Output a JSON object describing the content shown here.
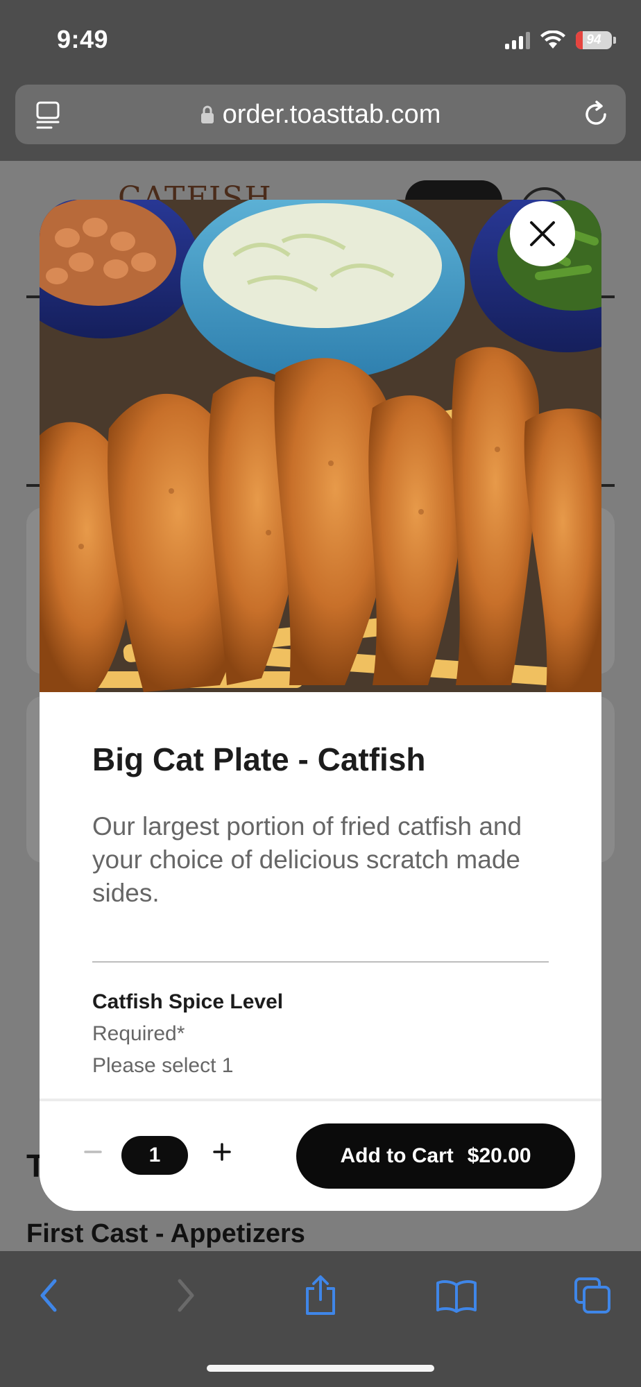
{
  "status_bar": {
    "time": "9:49",
    "battery": "94"
  },
  "browser": {
    "url": "order.toasttab.com"
  },
  "background_page": {
    "logo_text": "CATFISH",
    "partial_heading": "T",
    "section_title": "First Cast - Appetizers"
  },
  "modal": {
    "title": "Big Cat Plate - Catfish",
    "description": "Our largest portion of fried catfish and your choice of  delicious scratch made sides.",
    "modifier_group": {
      "title": "Catfish Spice Level",
      "required": "Required*",
      "instruction": "Please select 1"
    },
    "footer": {
      "quantity": "1",
      "add_to_cart_label": "Add to Cart",
      "price": "$20.00"
    }
  },
  "colors": {
    "accent": "#0b0b0b",
    "safari_blue": "#3f86e8",
    "battery_low": "#e5443f"
  },
  "toolbar_icons": [
    "back-icon",
    "forward-icon",
    "share-icon",
    "bookmarks-icon",
    "tabs-icon"
  ]
}
